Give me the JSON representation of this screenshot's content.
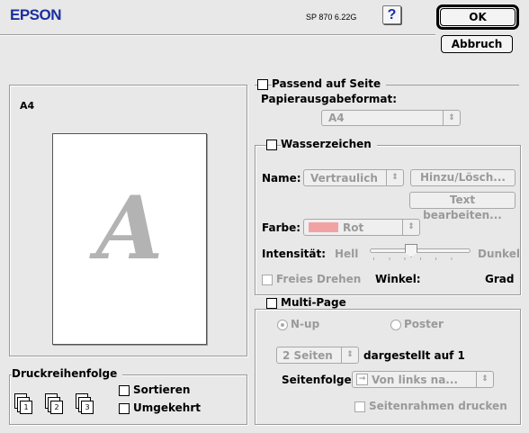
{
  "header": {
    "brand": "EPSON",
    "version": "SP 870 6.22G",
    "help_label": "?"
  },
  "buttons": {
    "ok_label": "OK",
    "cancel_label": "Abbruch"
  },
  "preview": {
    "paper_label": "A4",
    "watermark_letter": "A"
  },
  "fit_to_page": {
    "checkbox_label": "Passend auf Seite",
    "format_label": "Papierausgabeformat:",
    "format_value": "A4"
  },
  "watermark": {
    "checkbox_label": "Wasserzeichen",
    "name_label": "Name:",
    "name_value": "Vertraulich",
    "add_delete_label": "Hinzu/Lösch...",
    "edit_text_label": "Text bearbeiten...",
    "color_label": "Farbe:",
    "color_value": "Rot",
    "color_swatch": "#f1a3a3",
    "intensity_label": "Intensität:",
    "intensity_light": "Hell",
    "intensity_dark": "Dunkel",
    "intensity_level": 0.4,
    "free_rotate_label": "Freies Drehen",
    "angle_label": "Winkel:",
    "angle_unit": "Grad"
  },
  "multi_page": {
    "checkbox_label": "Multi-Page",
    "nup_label": "N-up",
    "poster_label": "Poster",
    "pages_value": "2 Seiten",
    "pages_suffix": "dargestellt auf 1",
    "order_label": "Seitenfolge:",
    "order_value": "Von links na...",
    "frame_label": "Seitenrahmen drucken"
  },
  "print_order": {
    "title": "Druckreihenfolge",
    "sort_label": "Sortieren",
    "reverse_label": "Umgekehrt",
    "page_numbers": [
      "1",
      "2",
      "3"
    ]
  }
}
